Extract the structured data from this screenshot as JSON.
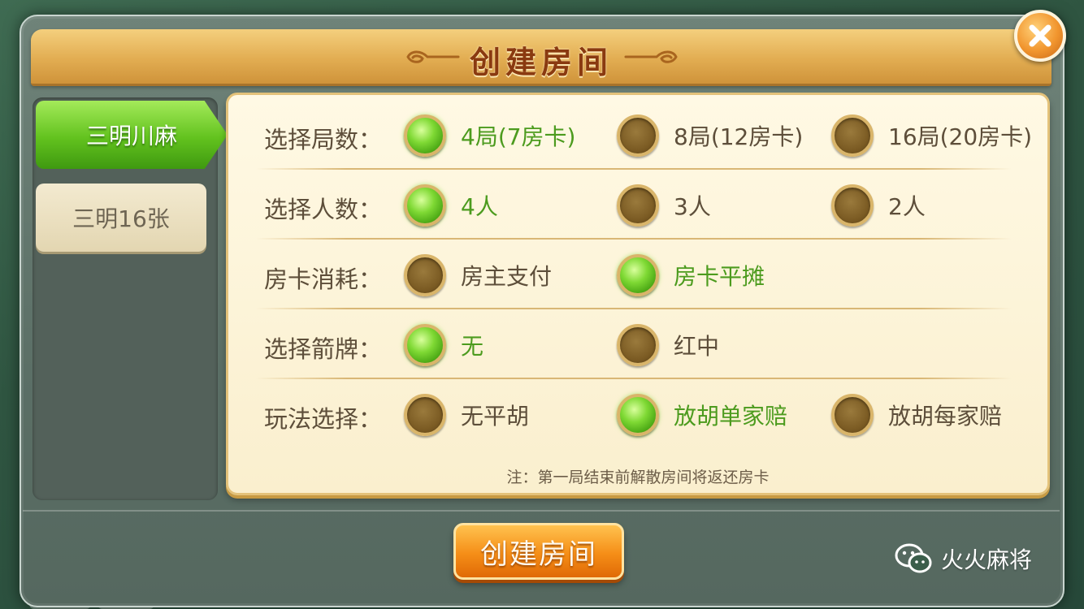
{
  "dialog": {
    "title": "创建房间",
    "create_button": "创建房间",
    "note": "注：第一局结束前解散房间将返还房卡"
  },
  "tabs": [
    {
      "label": "三明川麻",
      "active": true
    },
    {
      "label": "三明16张",
      "active": false
    }
  ],
  "rows": [
    {
      "label": "选择局数：",
      "options": [
        {
          "label": "4局(7房卡)",
          "selected": true
        },
        {
          "label": "8局(12房卡)",
          "selected": false
        },
        {
          "label": "16局(20房卡)",
          "selected": false
        }
      ]
    },
    {
      "label": "选择人数：",
      "options": [
        {
          "label": "4人",
          "selected": true
        },
        {
          "label": "3人",
          "selected": false
        },
        {
          "label": "2人",
          "selected": false
        }
      ]
    },
    {
      "label": "房卡消耗：",
      "options": [
        {
          "label": "房主支付",
          "selected": false
        },
        {
          "label": "房卡平摊",
          "selected": true
        }
      ]
    },
    {
      "label": "选择箭牌：",
      "options": [
        {
          "label": "无",
          "selected": true
        },
        {
          "label": "红中",
          "selected": false
        }
      ]
    },
    {
      "label": "玩法选择：",
      "options": [
        {
          "label": "无平胡",
          "selected": false
        },
        {
          "label": "放胡单家赔",
          "selected": true
        },
        {
          "label": "放胡每家赔",
          "selected": false
        }
      ]
    }
  ],
  "watermark": {
    "text": "火火麻将",
    "icon": "wechat-icon"
  },
  "colors": {
    "title_bar": "#e2ad52",
    "tab_active": "#62c21e",
    "radio_selected": "#7fd934",
    "selected_text": "#4c9b1e",
    "create_button": "#f58e17"
  }
}
